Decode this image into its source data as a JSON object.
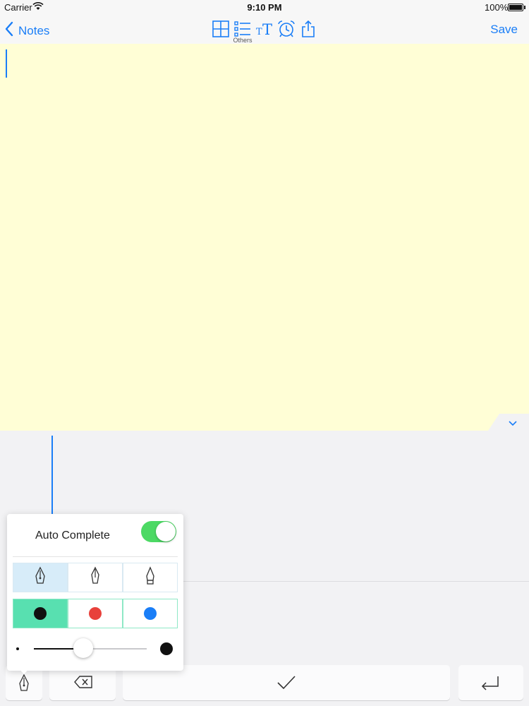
{
  "status_bar": {
    "carrier": "Carrier",
    "time": "9:10 PM",
    "battery": "100%"
  },
  "nav": {
    "back_label": "Notes",
    "save_label": "Save",
    "others_label": "Others",
    "toolbar_icons": [
      "grid-icon",
      "list-icon",
      "text-size-icon",
      "alarm-clock-icon",
      "share-icon"
    ]
  },
  "popover": {
    "auto_complete_label": "Auto Complete",
    "auto_complete_on": true,
    "pen_styles": [
      "fountain-pen-icon",
      "calligraphy-pen-icon",
      "marker-pen-icon"
    ],
    "selected_pen": 0,
    "ink_colors": [
      "#111111",
      "#e8413b",
      "#1a7ef7"
    ],
    "selected_color": 0,
    "stroke_width_level": 0.44
  },
  "colors": {
    "accent": "#1a7ef7",
    "editor_bg": "#fffed6",
    "toggle_on": "#4cd964",
    "selected_color_bg": "#58e0b0",
    "selected_pen_bg": "#d7ecf9"
  }
}
